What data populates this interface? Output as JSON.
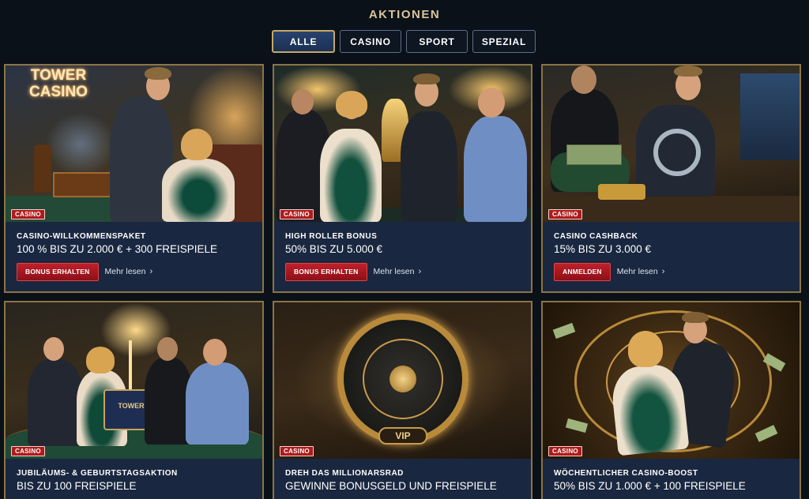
{
  "section": {
    "title": "AKTIONEN"
  },
  "tabs": [
    {
      "label": "ALLE",
      "active": true
    },
    {
      "label": "CASINO",
      "active": false
    },
    {
      "label": "SPORT",
      "active": false
    },
    {
      "label": "SPEZIAL",
      "active": false
    }
  ],
  "cards": [
    {
      "badge": "CASINO",
      "title": "CASINO-WILLKOMMENSPAKET",
      "subtitle": "100 % BIS ZU 2.000 € + 300 FREISPIELE",
      "button": "BONUS ERHALTEN",
      "more": "Mehr lesen",
      "sign": "TOWER CASINO"
    },
    {
      "badge": "CASINO",
      "title": "HIGH ROLLER BONUS",
      "subtitle": "50% BIS ZU 5.000 €",
      "button": "BONUS ERHALTEN",
      "more": "Mehr lesen"
    },
    {
      "badge": "CASINO",
      "title": "CASINO CASHBACK",
      "subtitle": "15% BIS ZU 3.000 €",
      "button": "ANMELDEN",
      "more": "Mehr lesen"
    },
    {
      "badge": "CASINO",
      "title": "JUBILÄUMS- & GEBURTSTAGSAKTION",
      "subtitle": "BIS ZU 100 FREISPIELE",
      "cake": "TOWER"
    },
    {
      "badge": "CASINO",
      "title": "DREH DAS MILLIONARSRAD",
      "subtitle": "GEWINNE BONUSGELD UND FREISPIELE",
      "wheel": "VIP"
    },
    {
      "badge": "CASINO",
      "title": "WÖCHENTLICHER CASINO-BOOST",
      "subtitle": "50% BIS ZU 1.000 € + 100 FREISPIELE"
    }
  ],
  "colors": {
    "page_bg": "#0b1119",
    "card_bg": "#1a2740",
    "card_border": "#8c7444",
    "tab_active_border": "#c5a867",
    "button_red": "#c0202a",
    "badge_red": "#b01a1a",
    "title_gold": "#d8c69a"
  },
  "icons": {
    "more": "chevron-right-icon"
  }
}
